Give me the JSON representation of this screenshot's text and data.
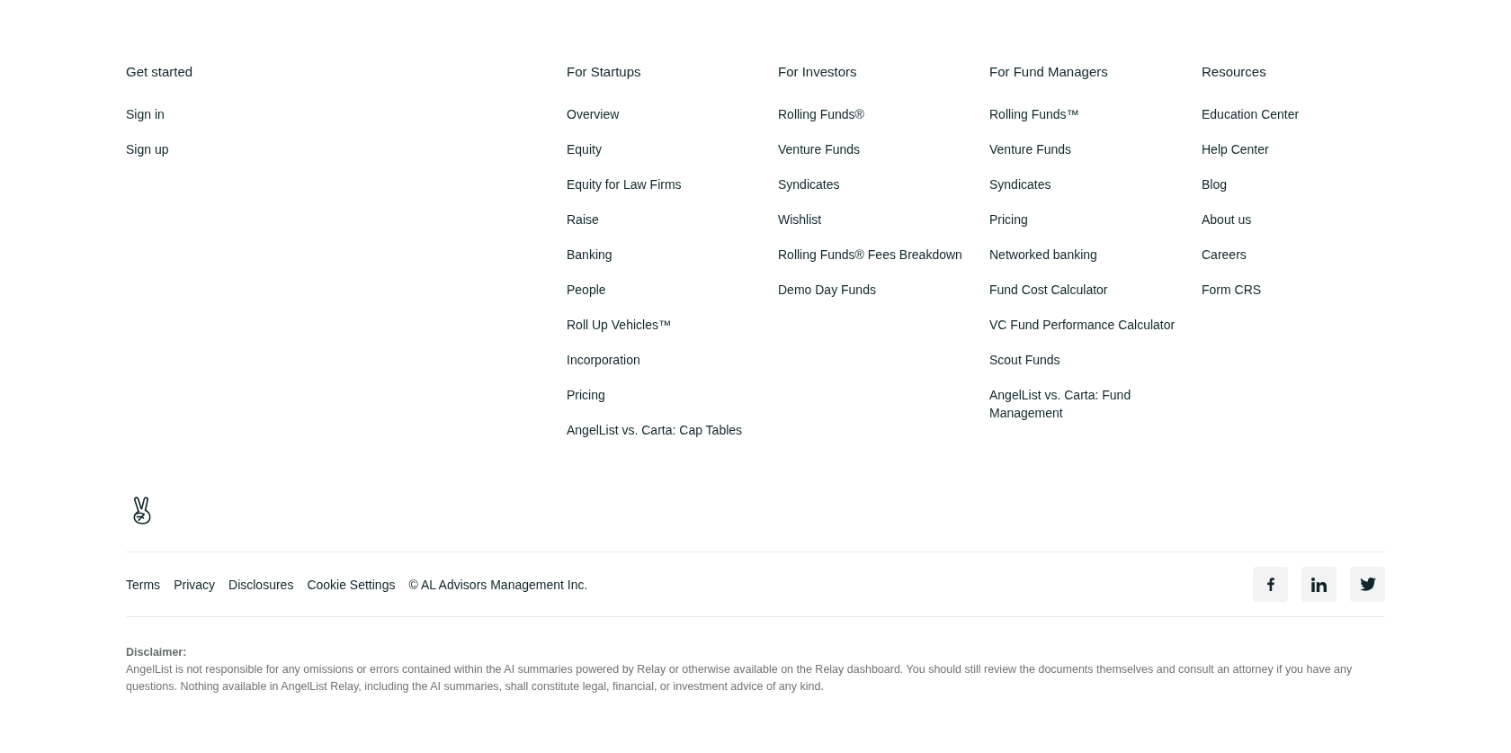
{
  "columns": [
    {
      "heading": "Get started",
      "links": [
        "Sign in",
        "Sign up"
      ]
    },
    {
      "heading": "For Startups",
      "links": [
        "Overview",
        "Equity",
        "Equity for Law Firms",
        "Raise",
        "Banking",
        "People",
        "Roll Up Vehicles™",
        "Incorporation",
        "Pricing",
        "AngelList vs. Carta: Cap Tables"
      ]
    },
    {
      "heading": "For Investors",
      "links": [
        "Rolling Funds®",
        "Venture Funds",
        "Syndicates",
        "Wishlist",
        "Rolling Funds® Fees Breakdown",
        "Demo Day Funds"
      ]
    },
    {
      "heading": "For Fund Managers",
      "links": [
        "Rolling Funds™",
        "Venture Funds",
        "Syndicates",
        "Pricing",
        "Networked banking",
        "Fund Cost Calculator",
        "VC Fund Performance Calculator",
        "Scout Funds",
        "AngelList vs. Carta: Fund Management"
      ]
    },
    {
      "heading": "Resources",
      "links": [
        "Education Center",
        "Help Center",
        "Blog",
        "About us",
        "Careers",
        "Form CRS"
      ]
    }
  ],
  "bottom_links": [
    "Terms",
    "Privacy",
    "Disclosures",
    "Cookie Settings"
  ],
  "copyright": "© AL Advisors Management Inc.",
  "social": [
    {
      "kind": "facebook"
    },
    {
      "kind": "linkedin"
    },
    {
      "kind": "twitter"
    }
  ],
  "disclaimer": {
    "label": "Disclaimer:",
    "text": "AngelList is not responsible for any omissions or errors contained within the AI summaries powered by Relay or otherwise available on the Relay dashboard. You should still review the documents themselves and consult an attorney if you have any questions. Nothing available in AngelList Relay, including the AI summaries, shall constitute legal, financial, or investment advice of any kind."
  }
}
